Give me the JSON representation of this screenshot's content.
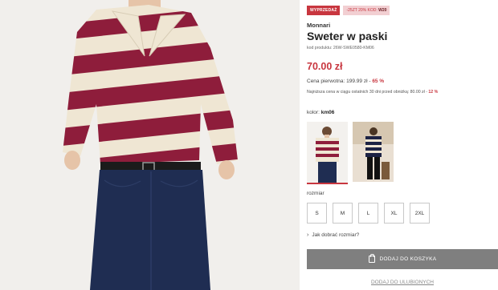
{
  "badges": {
    "sale": "WYPRZEDAŻ",
    "code_prefix": "-25ZT 20% KOD:",
    "code": "W20"
  },
  "product": {
    "brand": "Monnari",
    "title": "Sweter w paski",
    "sku": "kod produktu: 26W-SWE0580-KM06",
    "price": "70.00 zł",
    "original_price_label": "Cena pierwotna: 199.99 zł -",
    "original_discount": "65 %",
    "lowest_price_label": "Najniższa cena w ciągu ostatnich 30 dni przed obniżką: 80.00 zł -",
    "lowest_discount": "12 %"
  },
  "color": {
    "label": "kolor:",
    "value": "km06"
  },
  "size": {
    "label": "rozmiar",
    "options": [
      "S",
      "M",
      "L",
      "XL",
      "2XL"
    ]
  },
  "links": {
    "fit_help": "Jak dobrać rozmiar?",
    "wishlist": "DODAJ DO ULUBIONYCH"
  },
  "cart": {
    "label": "DODAJ DO KOSZYKA"
  },
  "colors": {
    "accent": "#c8363f",
    "stripe": "#8e1d3b",
    "cream": "#efe6d3",
    "button": "#7f7f7f",
    "jeans": "#1f2d52"
  },
  "icons": {
    "cart": "shopping-bag-icon",
    "chevron": "chevron-right-icon"
  }
}
